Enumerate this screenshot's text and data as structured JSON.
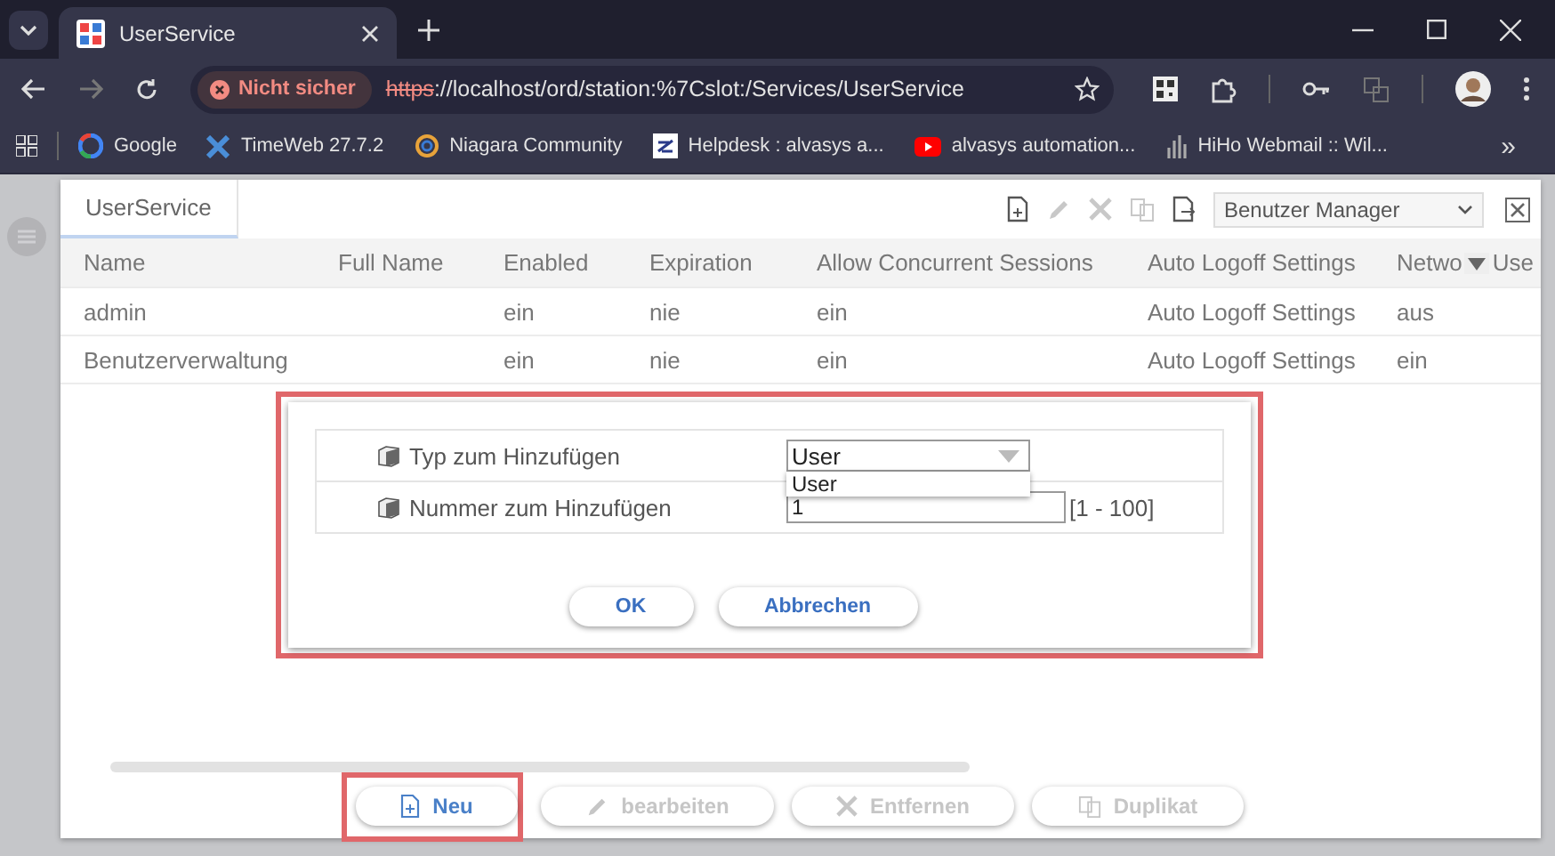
{
  "browser": {
    "tab_title": "UserService",
    "security_chip": "Nicht sicher",
    "url_scheme": "https",
    "url_rest": "://localhost/ord/station:%7Cslot:/Services/UserService",
    "bookmarks": [
      {
        "label": "Google",
        "kind": "google"
      },
      {
        "label": "TimeWeb 27.7.2",
        "kind": "cross"
      },
      {
        "label": "Niagara Community",
        "kind": "ring"
      },
      {
        "label": "Helpdesk : alvasys a...",
        "kind": "square"
      },
      {
        "label": "alvasys automation...",
        "kind": "play"
      },
      {
        "label": "HiHo Webmail :: Wil...",
        "kind": "bars"
      }
    ],
    "bookmarks_overflow": "»"
  },
  "panel": {
    "tab": {
      "label": "UserService",
      "selected": true
    },
    "toolbar": [
      {
        "kind": "new",
        "disabled": false
      },
      {
        "kind": "edit",
        "disabled": true
      },
      {
        "kind": "delete",
        "disabled": true
      },
      {
        "kind": "duplicate",
        "disabled": true
      },
      {
        "kind": "export",
        "disabled": false
      }
    ],
    "view_select": "Benutzer Manager",
    "table": {
      "columns": [
        "Name",
        "Full Name",
        "Enabled",
        "Expiration",
        "Allow Concurrent Sessions",
        "Auto Logoff Settings",
        "Netwo",
        "Use"
      ],
      "rows": [
        [
          "admin",
          "",
          "ein",
          "nie",
          "ein",
          "Auto Logoff Settings",
          "aus"
        ],
        [
          "Benutzerverwaltung",
          "",
          "ein",
          "nie",
          "ein",
          "Auto Logoff Settings",
          "ein"
        ]
      ]
    },
    "dialog": {
      "highlighted": true,
      "fields": [
        {
          "kind": "select",
          "label": "Typ zum Hinzufügen",
          "value": "User",
          "options": [
            "User"
          ]
        },
        {
          "kind": "number",
          "label": "Nummer zum Hinzufügen",
          "value": "1",
          "range": "[1 - 100]"
        }
      ],
      "buttons": [
        "OK",
        "Abbrechen"
      ]
    },
    "actions": [
      {
        "kind": "new",
        "label": "Neu",
        "disabled": false,
        "highlighted": true
      },
      {
        "kind": "edit",
        "label": "bearbeiten",
        "disabled": true,
        "highlighted": false
      },
      {
        "kind": "delete",
        "label": "Entfernen",
        "disabled": true,
        "highlighted": false
      },
      {
        "kind": "duplicate",
        "label": "Duplikat",
        "disabled": true,
        "highlighted": false
      }
    ]
  }
}
